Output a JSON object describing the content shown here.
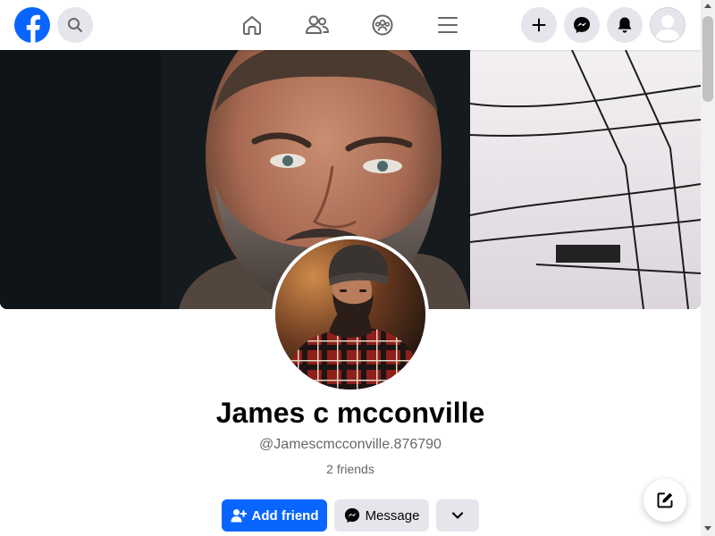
{
  "nav": {
    "logo_icon": "facebook-logo",
    "search_icon": "search-icon",
    "center_icons": [
      "home-icon",
      "friends-icon",
      "groups-icon",
      "menu-icon"
    ],
    "right_icons": [
      "plus-icon",
      "messenger-icon",
      "bell-icon"
    ],
    "account_avatar": "default-avatar"
  },
  "profile": {
    "name": "James c mcconville",
    "handle": "@Jamescmcconville.876790",
    "friends": "2 friends"
  },
  "actions": {
    "add_friend_label": "Add friend",
    "message_label": "Message",
    "more_icon": "chevron-down-icon"
  },
  "floating": {
    "compose_icon": "compose-icon"
  },
  "colors": {
    "brand": "#0866ff",
    "button_gray": "#e4e6eb",
    "text_primary": "#050505",
    "text_secondary": "#65676b"
  }
}
